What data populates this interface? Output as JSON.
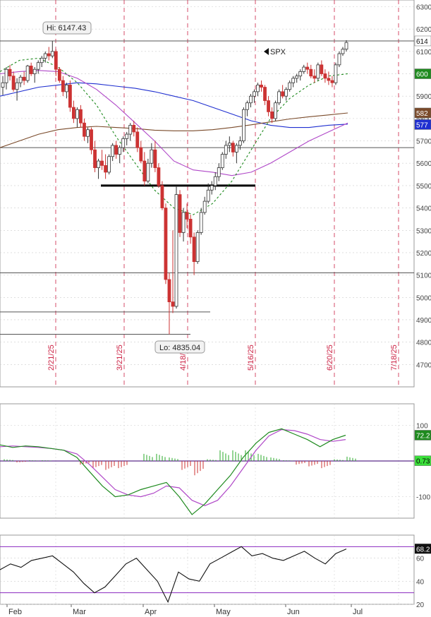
{
  "chart_data": {
    "type": "candlestick",
    "symbol": "SPX",
    "panels": {
      "price": {
        "ylim": [
          4600,
          6330
        ],
        "y_ticks": [
          4700,
          4800,
          4900,
          5000,
          5100,
          5200,
          5300,
          5400,
          5500,
          5600,
          5700,
          5800,
          5900,
          6000,
          6100,
          6200,
          6300
        ],
        "y_tick_labels": [
          "4700",
          "4800",
          "4900",
          "5000",
          "5100",
          "5200",
          "5300",
          "5400",
          "5500",
          "5600",
          "5700",
          "5800",
          "5900",
          "6000",
          "6100",
          "6200",
          "6300"
        ],
        "annotations": {
          "high_label": "Hi: 6147.43",
          "low_label": "Lo: 4835.04",
          "symbol_label": "SPX"
        },
        "vertical_date_labels": [
          "2/21/25",
          "3/21/25",
          "4/18/25",
          "5/16/25",
          "6/20/25",
          "7/18/25"
        ],
        "right_value_tags": [
          {
            "text": "614",
            "bg": "#ffffff",
            "fg": "#111111",
            "value": 6147
          },
          {
            "text": "600",
            "bg": "#1e8a1e",
            "fg": "#ffffff",
            "value": 6000
          },
          {
            "text": "582",
            "bg": "#7a4a2a",
            "fg": "#ffffff",
            "value": 5825
          },
          {
            "text": "577",
            "bg": "#1f2fd0",
            "fg": "#ffffff",
            "value": 5773
          }
        ],
        "horizontal_levels": [
          6147,
          5670,
          5500,
          5110,
          4935,
          4835
        ],
        "candles": [
          [
            5940,
            5990,
            5905,
            5960
          ],
          [
            5960,
            6030,
            5930,
            6020
          ],
          [
            6020,
            6040,
            5970,
            5990
          ],
          [
            5990,
            6010,
            5920,
            5930
          ],
          [
            5930,
            5980,
            5880,
            5960
          ],
          [
            5960,
            5995,
            5940,
            5985
          ],
          [
            5985,
            6010,
            5950,
            5970
          ],
          [
            5970,
            6040,
            5960,
            6035
          ],
          [
            6035,
            6050,
            5990,
            6000
          ],
          [
            6000,
            6030,
            5960,
            6020
          ],
          [
            6020,
            6060,
            6000,
            6050
          ],
          [
            6050,
            6080,
            6030,
            6070
          ],
          [
            6070,
            6100,
            6050,
            6090
          ],
          [
            6090,
            6120,
            6060,
            6080
          ],
          [
            6080,
            6147,
            6070,
            6100
          ],
          [
            6100,
            6110,
            5990,
            6020
          ],
          [
            6020,
            6030,
            5960,
            5970
          ],
          [
            5970,
            5990,
            5900,
            5920
          ],
          [
            5920,
            5960,
            5890,
            5950
          ],
          [
            5950,
            5970,
            5830,
            5850
          ],
          [
            5850,
            5880,
            5780,
            5800
          ],
          [
            5800,
            5850,
            5760,
            5840
          ],
          [
            5840,
            5860,
            5760,
            5780
          ],
          [
            5780,
            5800,
            5700,
            5720
          ],
          [
            5720,
            5760,
            5690,
            5750
          ],
          [
            5750,
            5760,
            5640,
            5660
          ],
          [
            5660,
            5700,
            5560,
            5580
          ],
          [
            5580,
            5620,
            5530,
            5610
          ],
          [
            5610,
            5660,
            5570,
            5590
          ],
          [
            5590,
            5640,
            5530,
            5560
          ],
          [
            5560,
            5640,
            5550,
            5630
          ],
          [
            5630,
            5690,
            5610,
            5680
          ],
          [
            5680,
            5700,
            5620,
            5640
          ],
          [
            5640,
            5680,
            5600,
            5670
          ],
          [
            5670,
            5720,
            5650,
            5710
          ],
          [
            5710,
            5740,
            5680,
            5730
          ],
          [
            5730,
            5780,
            5700,
            5770
          ],
          [
            5770,
            5790,
            5720,
            5740
          ],
          [
            5740,
            5760,
            5650,
            5670
          ],
          [
            5670,
            5700,
            5600,
            5610
          ],
          [
            5610,
            5650,
            5500,
            5520
          ],
          [
            5520,
            5620,
            5510,
            5600
          ],
          [
            5600,
            5690,
            5580,
            5660
          ],
          [
            5660,
            5700,
            5560,
            5580
          ],
          [
            5580,
            5600,
            5490,
            5500
          ],
          [
            5500,
            5520,
            5390,
            5400
          ],
          [
            5400,
            5420,
            5060,
            5080
          ],
          [
            5080,
            5110,
            4835,
            4980
          ],
          [
            4980,
            5300,
            4930,
            4960
          ],
          [
            4960,
            5500,
            4950,
            5460
          ],
          [
            5460,
            5480,
            5270,
            5290
          ],
          [
            5290,
            5400,
            5250,
            5380
          ],
          [
            5380,
            5420,
            5310,
            5350
          ],
          [
            5350,
            5370,
            5240,
            5270
          ],
          [
            5270,
            5290,
            5100,
            5160
          ],
          [
            5160,
            5300,
            5150,
            5290
          ],
          [
            5290,
            5400,
            5280,
            5380
          ],
          [
            5380,
            5450,
            5370,
            5430
          ],
          [
            5430,
            5510,
            5420,
            5480
          ],
          [
            5480,
            5520,
            5460,
            5500
          ],
          [
            5500,
            5560,
            5480,
            5540
          ],
          [
            5540,
            5600,
            5520,
            5580
          ],
          [
            5580,
            5650,
            5570,
            5640
          ],
          [
            5640,
            5700,
            5620,
            5680
          ],
          [
            5680,
            5720,
            5650,
            5690
          ],
          [
            5690,
            5700,
            5630,
            5650
          ],
          [
            5650,
            5690,
            5600,
            5680
          ],
          [
            5680,
            5720,
            5660,
            5700
          ],
          [
            5700,
            5850,
            5690,
            5840
          ],
          [
            5840,
            5880,
            5810,
            5870
          ],
          [
            5870,
            5910,
            5850,
            5900
          ],
          [
            5900,
            5930,
            5870,
            5920
          ],
          [
            5920,
            5960,
            5900,
            5950
          ],
          [
            5950,
            5970,
            5920,
            5940
          ],
          [
            5940,
            5950,
            5860,
            5880
          ],
          [
            5880,
            5900,
            5810,
            5830
          ],
          [
            5830,
            5850,
            5780,
            5800
          ],
          [
            5800,
            5880,
            5790,
            5870
          ],
          [
            5870,
            5930,
            5860,
            5920
          ],
          [
            5920,
            5950,
            5890,
            5900
          ],
          [
            5900,
            5940,
            5880,
            5930
          ],
          [
            5930,
            5970,
            5920,
            5960
          ],
          [
            5960,
            5990,
            5940,
            5980
          ],
          [
            5980,
            6000,
            5960,
            5990
          ],
          [
            5990,
            6020,
            5970,
            6010
          ],
          [
            6010,
            6040,
            6000,
            6030
          ],
          [
            6030,
            6050,
            6000,
            6020
          ],
          [
            6020,
            6040,
            5980,
            5990
          ],
          [
            5990,
            6020,
            5960,
            5980
          ],
          [
            5980,
            6050,
            5970,
            6040
          ],
          [
            6040,
            6060,
            5990,
            6000
          ],
          [
            6000,
            6020,
            5960,
            5980
          ],
          [
            5980,
            6010,
            5950,
            5970
          ],
          [
            5970,
            5990,
            5940,
            5960
          ],
          [
            5960,
            6050,
            5950,
            6040
          ],
          [
            6040,
            6100,
            6030,
            6090
          ],
          [
            6090,
            6120,
            6080,
            6110
          ],
          [
            6110,
            6150,
            6100,
            6140
          ]
        ],
        "overlays": [
          {
            "name": "",
            "color": "#1f2fd0",
            "values": [
              5900,
              5920,
              5940,
              5950,
              5960,
              5955,
              5945,
              5935,
              5920,
              5900,
              5880,
              5850,
              5820,
              5790,
              5770,
              5760,
              5760,
              5770,
              5775
            ]
          },
          {
            "name": "",
            "color": "#7a4a2a",
            "values": [
              5670,
              5700,
              5730,
              5750,
              5760,
              5765,
              5760,
              5755,
              5748,
              5745,
              5745,
              5750,
              5760,
              5772,
              5785,
              5798,
              5808,
              5816,
              5825
            ]
          },
          {
            "name": "",
            "color": "#b048c8",
            "values": [
              6000,
              6010,
              6015,
              6010,
              5980,
              5930,
              5860,
              5780,
              5700,
              5610,
              5570,
              5560,
              5545,
              5560,
              5600,
              5650,
              5700,
              5740,
              5780
            ]
          },
          {
            "name": "",
            "color": "#1e8a1e",
            "values": [
              6010,
              6060,
              6070,
              6030,
              5960,
              5860,
              5720,
              5600,
              5480,
              5400,
              5370,
              5420,
              5520,
              5660,
              5800,
              5890,
              5950,
              5990,
              6000
            ]
          }
        ]
      },
      "macd": {
        "ylim": [
          -160,
          160
        ],
        "y_ticks": [
          100,
          -100
        ],
        "y_tick_labels": [
          "100",
          "-100"
        ],
        "tags": [
          {
            "text": "72.2",
            "bg": "#1e8a1e",
            "fg": "#ffffff",
            "value": 72.2
          },
          {
            "text": "0.73",
            "bg": "#3ae03a",
            "fg": "#000000",
            "value": 0.73
          }
        ],
        "macd_line": [
          45,
          38,
          42,
          40,
          35,
          30,
          10,
          -30,
          -70,
          -100,
          -95,
          -80,
          -70,
          -60,
          -100,
          -150,
          -120,
          -80,
          -40,
          10,
          50,
          80,
          90,
          75,
          60,
          40,
          60,
          72
        ],
        "signal_line": [
          40,
          42,
          40,
          38,
          35,
          30,
          20,
          -10,
          -45,
          -80,
          -95,
          -100,
          -90,
          -70,
          -75,
          -110,
          -125,
          -110,
          -70,
          -20,
          30,
          70,
          88,
          85,
          75,
          60,
          55,
          60
        ],
        "histogram": [
          5,
          -4,
          2,
          2,
          0,
          0,
          -10,
          -20,
          -25,
          -20,
          0,
          20,
          20,
          10,
          -25,
          -40,
          5,
          30,
          30,
          30,
          20,
          10,
          2,
          -10,
          -15,
          -20,
          5,
          12
        ]
      },
      "rsi": {
        "ylim": [
          20,
          80
        ],
        "y_ticks": [
          60,
          40,
          20
        ],
        "y_tick_labels": [
          "60",
          "40",
          "20"
        ],
        "bands": [
          70,
          30
        ],
        "tag": {
          "text": "68.2",
          "bg": "#111111",
          "fg": "#ffffff",
          "value": 68.2
        },
        "values": [
          50,
          55,
          52,
          58,
          60,
          62,
          55,
          48,
          38,
          30,
          35,
          45,
          55,
          60,
          50,
          40,
          22,
          48,
          42,
          40,
          55,
          60,
          65,
          70,
          62,
          64,
          60,
          58,
          62,
          66,
          60,
          55,
          64,
          68
        ]
      }
    },
    "x_month_labels": [
      "Feb",
      "Mar",
      "Apr",
      "May",
      "Jun",
      "Jul"
    ],
    "grid": true,
    "colors": {
      "up": "#2a8a2a",
      "down": "#cc3333",
      "grid": "#cccccc",
      "dashed_vlines": "#cc2244"
    }
  }
}
